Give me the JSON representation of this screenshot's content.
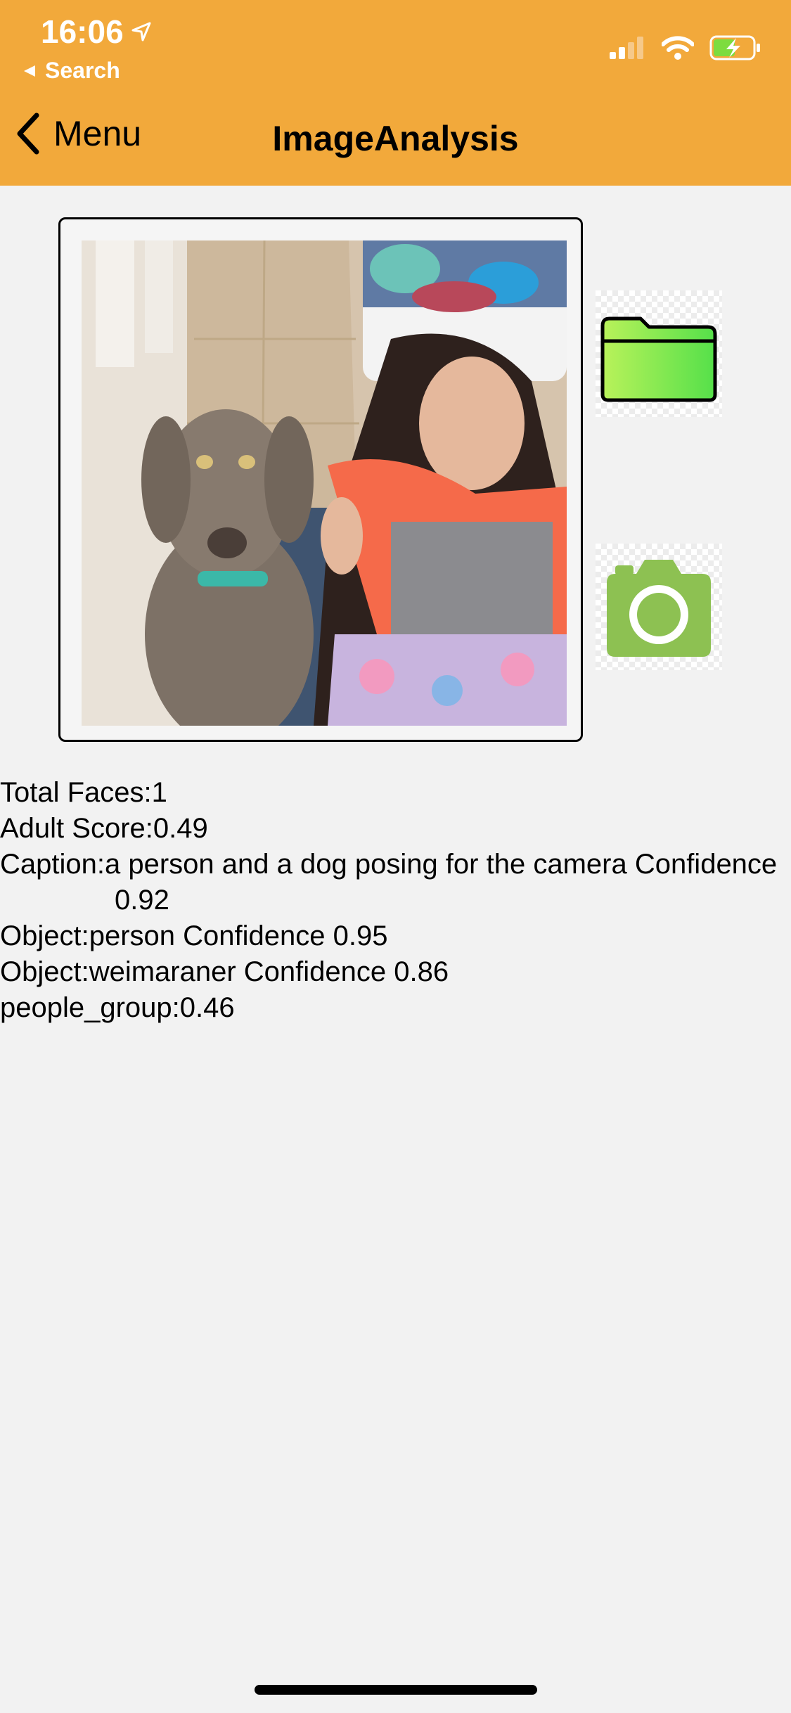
{
  "status_bar": {
    "time": "16:06",
    "back_app_label": "Search"
  },
  "nav": {
    "back_label": "Menu",
    "title": "ImageAnalysis"
  },
  "buttons": {
    "folder_icon": "folder-icon",
    "camera_icon": "camera-icon"
  },
  "results": {
    "total_faces": "Total Faces:1",
    "adult_score": "Adult Score:0.49",
    "caption": "Caption:a person and a dog posing for the camera Confidence",
    "caption_confidence": "0.92",
    "object_1": "Object:person Confidence 0.95",
    "object_2": "Object:weimaraner Confidence 0.86",
    "people_group": "people_group:0.46"
  },
  "colors": {
    "header": "#f2a93b",
    "folder_green": "#7ee34a",
    "camera_green": "#8dc152"
  }
}
